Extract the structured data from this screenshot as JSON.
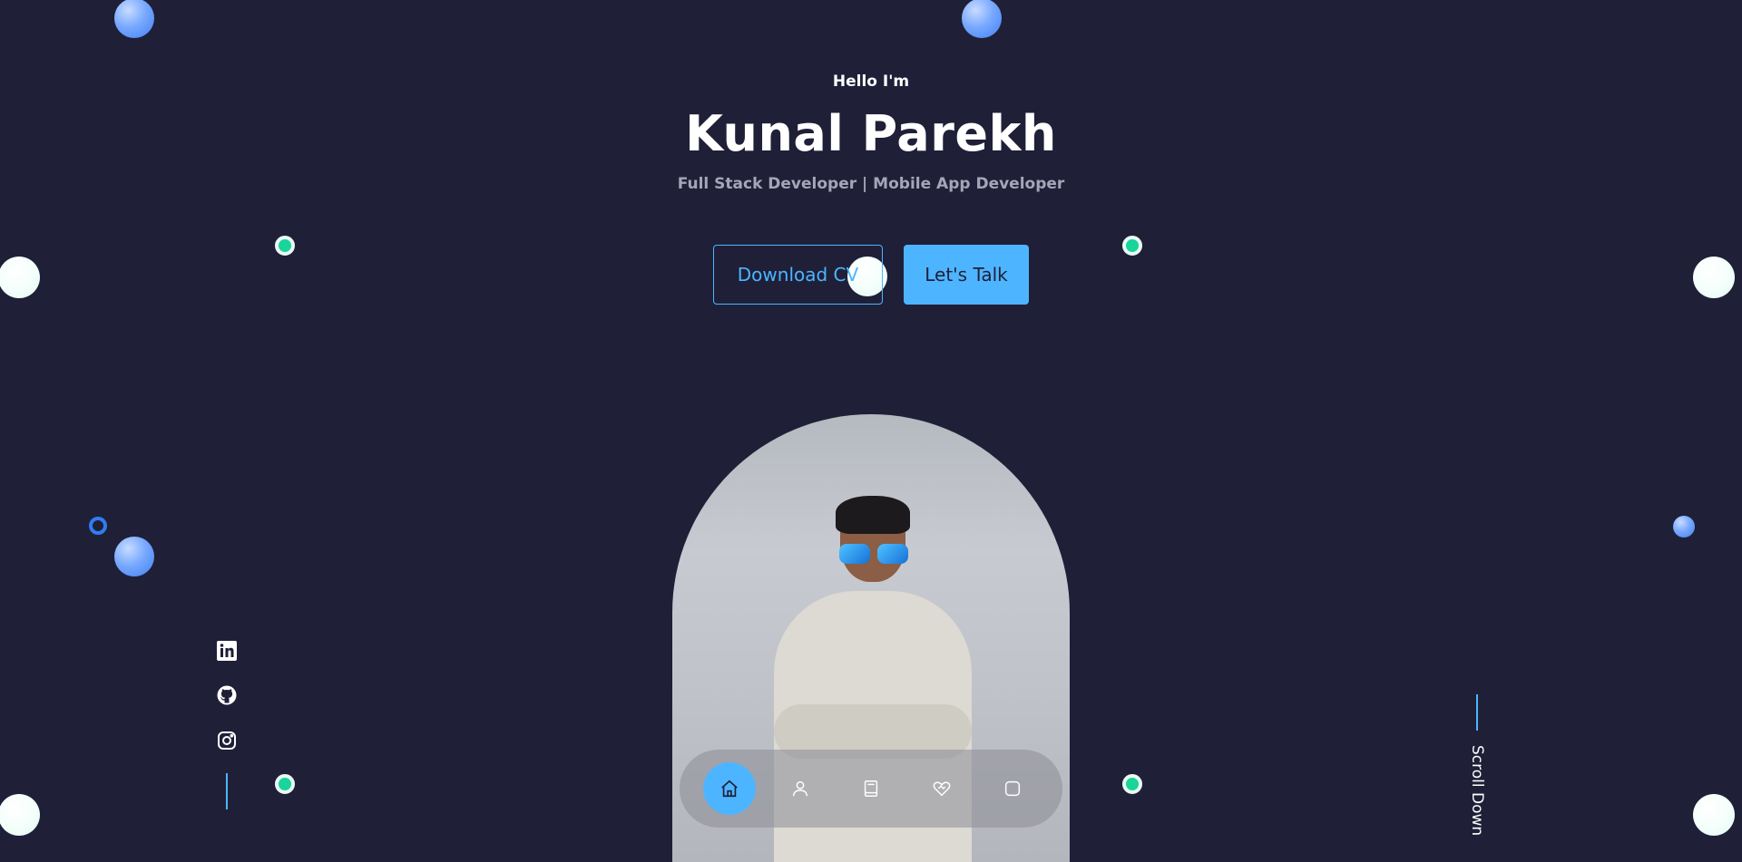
{
  "hero": {
    "greeting": "Hello I'm",
    "name": "Kunal Parekh",
    "role": "Full Stack Developer | Mobile App Developer"
  },
  "buttons": {
    "download_cv": "Download CV",
    "lets_talk": "Let's Talk"
  },
  "nav": {
    "items": [
      {
        "icon": "home-icon",
        "active": true
      },
      {
        "icon": "user-icon",
        "active": false
      },
      {
        "icon": "book-icon",
        "active": false
      },
      {
        "icon": "services-icon",
        "active": false
      },
      {
        "icon": "message-icon",
        "active": false
      }
    ]
  },
  "socials": [
    "linkedin-icon",
    "github-icon",
    "instagram-icon"
  ],
  "scroll": {
    "label": "Scroll Down"
  },
  "colors": {
    "background": "#1f1f38",
    "accent": "#4db5ff",
    "muted_text": "#a4a6b8",
    "dot_green": "#19d49b"
  }
}
